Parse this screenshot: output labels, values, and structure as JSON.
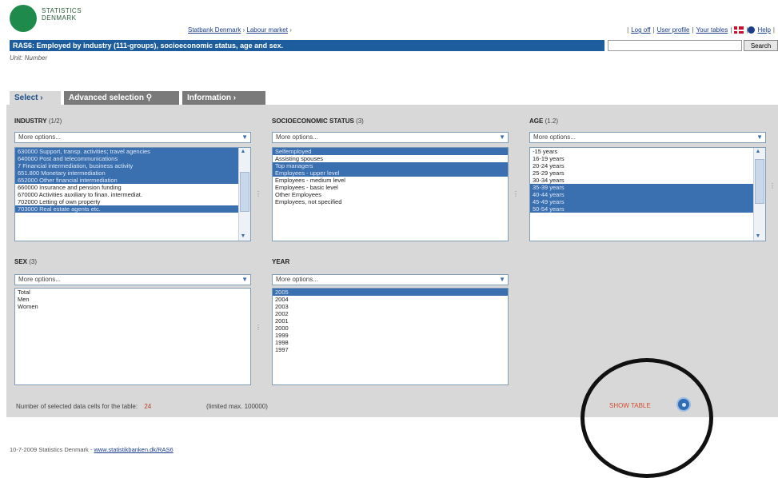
{
  "header": {
    "logo_line1": "STATISTICS",
    "logo_line2": "DENMARK",
    "breadcrumb": {
      "home": "Statbank Denmark",
      "section": "Labour market"
    },
    "links": {
      "logoff": "Log off",
      "profile": "User profile",
      "tables": "Your tables",
      "help": "Help"
    },
    "title": "RAS6: Employed by industry (111-groups), socioeconomic status, age and sex.",
    "unit": "Unit: Number",
    "search_button": "Search"
  },
  "tabs": {
    "select": "Select ›",
    "advanced": "Advanced selection",
    "information": "Information ›"
  },
  "variables": {
    "industry": {
      "label": "INDUSTRY",
      "count": "(1/2)",
      "more_options": "More options...",
      "items": [
        {
          "text": "630000 Support, transp. activities; travel agencies",
          "selected": true
        },
        {
          "text": "640000 Post and telecommunications",
          "selected": true
        },
        {
          "text": "7 Financial intermediation, business activity",
          "selected": true
        },
        {
          "text": "651.800 Monetary intermediation",
          "selected": true
        },
        {
          "text": "652000 Other financial intermediation",
          "selected": true
        },
        {
          "text": "660000 Insurance and pension funding",
          "selected": false
        },
        {
          "text": "670000 Activities auxiliary to finan. intermediat.",
          "selected": false
        },
        {
          "text": "702000 Letting of own property",
          "selected": false
        },
        {
          "text": "703000 Real estate agents etc.",
          "selected": true
        }
      ]
    },
    "socio": {
      "label": "SOCIOECONOMIC STATUS",
      "count": "(3)",
      "more_options": "More options...",
      "items": [
        {
          "text": "Selfemployed",
          "selected": true
        },
        {
          "text": "Assisting spouses",
          "selected": false
        },
        {
          "text": "Top managers",
          "selected": true
        },
        {
          "text": "Employees - upper level",
          "selected": true
        },
        {
          "text": "Employees - medium level",
          "selected": false
        },
        {
          "text": "Employees - basic level",
          "selected": false
        },
        {
          "text": "Other Employees",
          "selected": false
        },
        {
          "text": "Employees, not specified",
          "selected": false
        }
      ]
    },
    "age": {
      "label": "AGE",
      "count": "(1.2)",
      "more_options": "More options...",
      "items": [
        {
          "text": "-15 years",
          "selected": false
        },
        {
          "text": "16-19 years",
          "selected": false
        },
        {
          "text": "20-24 years",
          "selected": false
        },
        {
          "text": "25-29 years",
          "selected": false
        },
        {
          "text": "30-34 years",
          "selected": false
        },
        {
          "text": "35-39 years",
          "selected": true
        },
        {
          "text": "40-44 years",
          "selected": true
        },
        {
          "text": "45-49 years",
          "selected": true
        },
        {
          "text": "50-54 years",
          "selected": true
        }
      ]
    },
    "sex": {
      "label": "SEX",
      "count": "(3)",
      "more_options": "More options...",
      "items": [
        {
          "text": "Total",
          "selected": false
        },
        {
          "text": "Men",
          "selected": false
        },
        {
          "text": "Women",
          "selected": false
        }
      ]
    },
    "year": {
      "label": "YEAR",
      "count": "",
      "more_options": "More options...",
      "items": [
        {
          "text": "2005",
          "selected": true
        },
        {
          "text": "2004",
          "selected": false
        },
        {
          "text": "2003",
          "selected": false
        },
        {
          "text": "2002",
          "selected": false
        },
        {
          "text": "2001",
          "selected": false
        },
        {
          "text": "2000",
          "selected": false
        },
        {
          "text": "1999",
          "selected": false
        },
        {
          "text": "1998",
          "selected": false
        },
        {
          "text": "1997",
          "selected": false
        }
      ]
    }
  },
  "bottom": {
    "selected_cells_label": "Number of selected data cells for the table:",
    "selected_cells_value": "24",
    "limited_label": "(limited max. 100000)",
    "show_table": "SHOW TABLE"
  },
  "footer": {
    "date_text": "10-7-2009 Statistics Denmark",
    "url": "www.statistikbanken.dk/RAS6"
  },
  "colors": {
    "title_bar": "#1d5d9d",
    "selected": "#3a6fb0",
    "panel": "#d8d8d8",
    "show_table": "#d24d2f"
  }
}
